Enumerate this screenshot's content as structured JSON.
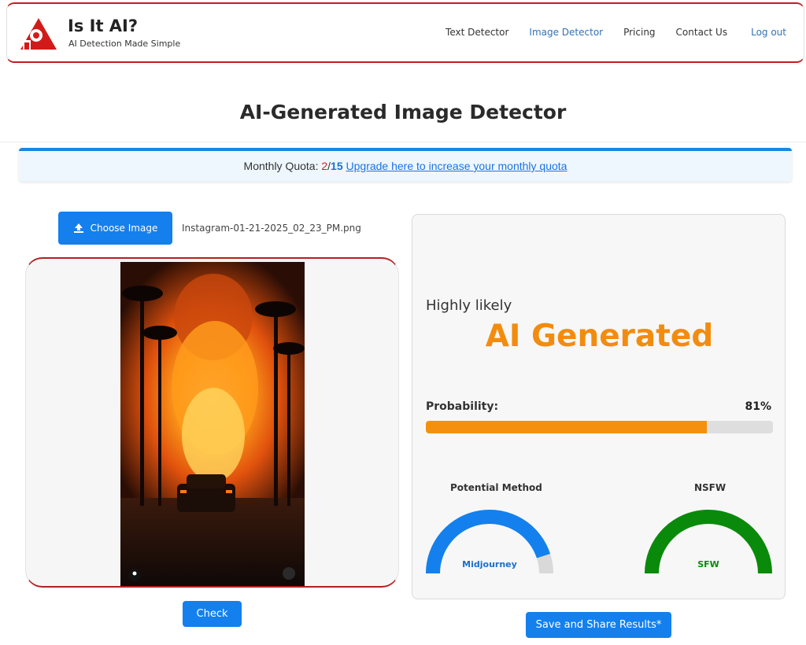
{
  "header": {
    "brand_title": "Is It AI?",
    "brand_subtitle": "AI Detection Made Simple",
    "nav": [
      {
        "label": "Text Detector"
      },
      {
        "label": "Image Detector"
      },
      {
        "label": "Pricing"
      },
      {
        "label": "Contact Us"
      },
      {
        "label": "Log out"
      }
    ]
  },
  "page": {
    "title": "AI-Generated Image Detector"
  },
  "quota": {
    "label": "Monthly Quota: ",
    "used": "2",
    "separator": "/",
    "total": "15",
    "upgrade_link": "Upgrade here to increase your monthly quota"
  },
  "upload": {
    "choose_label": "Choose Image",
    "filename": "Instagram-01-21-2025_02_23_PM.png",
    "check_label": "Check"
  },
  "result": {
    "likelihood": "Highly likely",
    "verdict": "AI Generated",
    "probability_label": "Probability:",
    "probability_text": "81%",
    "probability_value": 0.81,
    "method_title": "Potential Method",
    "method_value": "Midjourney",
    "method_fraction": 0.9,
    "nsfw_title": "NSFW",
    "nsfw_value": "SFW",
    "nsfw_fraction": 1.0
  },
  "actions": {
    "save_label": "Save and Share Results*"
  },
  "colors": {
    "accent": "#1380ee",
    "brand_red": "#c41d1d",
    "verdict_orange": "#f28c0f",
    "sfw_green": "#0a8a0a",
    "method_blue": "#1380ee"
  }
}
